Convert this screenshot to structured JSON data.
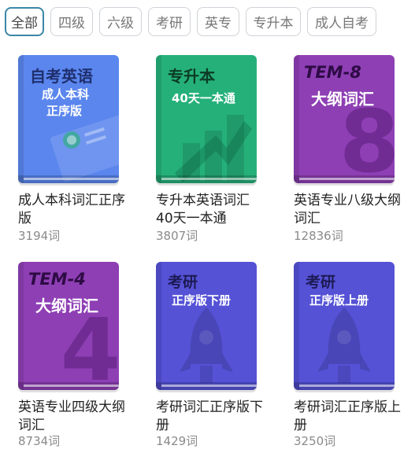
{
  "tabs": [
    {
      "label": "全部",
      "active": true
    },
    {
      "label": "四级"
    },
    {
      "label": "六级"
    },
    {
      "label": "考研"
    },
    {
      "label": "英专"
    },
    {
      "label": "专升本"
    },
    {
      "label": "成人自考"
    }
  ],
  "books": [
    {
      "cover_title": "自考英语",
      "cover_sub1": "成人本科",
      "cover_sub2": "正序版",
      "name": "成人本科词汇正序版",
      "count": "3194词",
      "color": "#5a86ee",
      "icon": "certificate-icon"
    },
    {
      "cover_title": "专升本",
      "cover_sub1": "40天一本通",
      "name": "专升本英语词汇40天一本通",
      "count": "3807词",
      "color": "#25b07a",
      "icon": "rising-chart-icon"
    },
    {
      "cover_title": "TEM-8",
      "cover_sub1": "大纲词汇",
      "cover_numeral": "8",
      "name": "英语专业八级大纲词汇",
      "count": "12836词",
      "color": "#8e3fb4",
      "icon": "numeral-8-icon"
    },
    {
      "cover_title": "TEM-4",
      "cover_sub1": "大纲词汇",
      "cover_numeral": "4",
      "name": "英语专业四级大纲词汇",
      "count": "8734词",
      "color": "#8e3fb4",
      "icon": "numeral-4-icon"
    },
    {
      "cover_title": "考研",
      "cover_sub1": "正序版下册",
      "name": "考研词汇正序版下册",
      "count": "1429词",
      "color": "#5552d6",
      "icon": "rocket-icon"
    },
    {
      "cover_title": "考研",
      "cover_sub1": "正序版上册",
      "name": "考研词汇正序版上册",
      "count": "3250词",
      "color": "#5552d6",
      "icon": "rocket-icon"
    }
  ]
}
